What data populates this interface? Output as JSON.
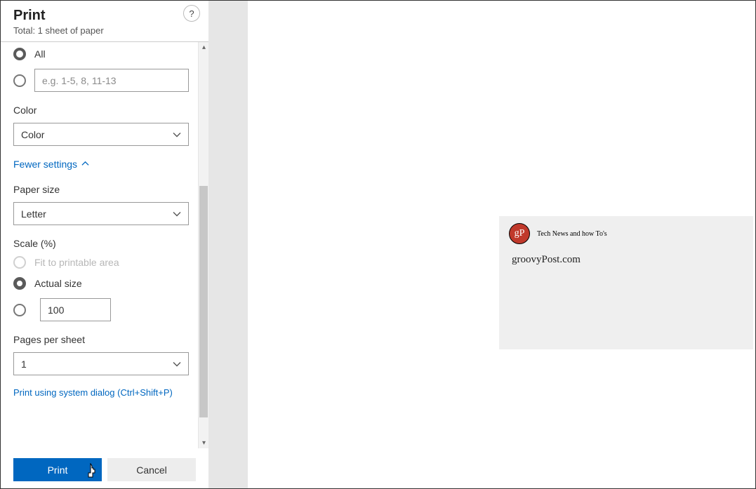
{
  "header": {
    "title": "Print",
    "subtitle": "Total: 1 sheet of paper",
    "help_tooltip": "?"
  },
  "pages": {
    "all_label": "All",
    "range_placeholder": "e.g. 1-5, 8, 11-13"
  },
  "color": {
    "label": "Color",
    "value": "Color"
  },
  "toggle": {
    "fewer_label": "Fewer settings"
  },
  "paper_size": {
    "label": "Paper size",
    "value": "Letter"
  },
  "scale": {
    "label": "Scale (%)",
    "fit_label": "Fit to printable area",
    "actual_label": "Actual size",
    "custom_value": "100"
  },
  "pps": {
    "label": "Pages per sheet",
    "value": "1"
  },
  "system_dialog_link": "Print using system dialog (Ctrl+Shift+P)",
  "buttons": {
    "print": "Print",
    "cancel": "Cancel"
  },
  "preview": {
    "logo_text": "gP",
    "tagline": "Tech News and how To's",
    "site": "groovyPost.com"
  }
}
